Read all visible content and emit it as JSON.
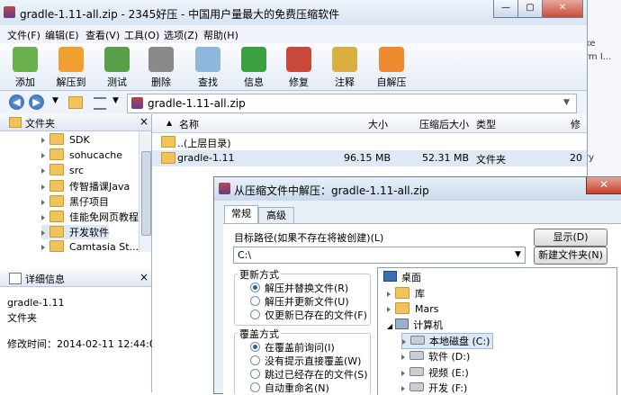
{
  "background_window": {
    "frag1": "ke",
    "frag2": "rm I...",
    "frag3": "ry"
  },
  "window": {
    "title": "gradle-1.11-all.zip - 2345好压 - 中国用户量最大的免费压缩软件"
  },
  "menu": [
    "文件(F)",
    "编辑(E)",
    "查看(V)",
    "工具(O)",
    "选项(Z)",
    "帮助(H)"
  ],
  "toolbar": [
    {
      "label": "添加",
      "icon": "add-archive-icon",
      "color": "#6ab04c"
    },
    {
      "label": "解压到",
      "icon": "extract-to-icon",
      "color": "#f0a030"
    },
    {
      "label": "测试",
      "icon": "test-icon",
      "color": "#5aa04a"
    },
    {
      "label": "删除",
      "icon": "delete-icon",
      "color": "#8a8a8a"
    },
    {
      "label": "查找",
      "icon": "find-icon",
      "color": "#8fb8dc"
    },
    {
      "label": "信息",
      "icon": "info-icon",
      "color": "#3aa040"
    },
    {
      "label": "修复",
      "icon": "repair-icon",
      "color": "#c94a3a"
    },
    {
      "label": "注释",
      "icon": "comment-icon",
      "color": "#d9b040"
    },
    {
      "label": "自解压",
      "icon": "self-extract-icon",
      "color": "#f08a30"
    }
  ],
  "address": {
    "path": "gradle-1.11-all.zip"
  },
  "left_pane": {
    "header": "文件夹",
    "tree": [
      "SDK",
      "sohucache",
      "src",
      "传智播课Java",
      "黑仔项目",
      "佳能免网页教程",
      "开发软件",
      "Camtasia St..."
    ],
    "details_header": "详细信息",
    "detail_name": "gradle-1.11",
    "detail_type": "文件夹",
    "detail_modified": "修改时间：2014-02-11 12:44:02"
  },
  "list": {
    "columns": {
      "name": "名称",
      "size": "大小",
      "packed": "压缩后大小",
      "type": "类型",
      "mod": "修"
    },
    "rows": [
      {
        "name": "..(上层目录)",
        "size": "",
        "packed": "",
        "type": ""
      },
      {
        "name": "gradle-1.11",
        "size": "96.15 MB",
        "packed": "52.31 MB",
        "type": "文件夹",
        "mod": "20"
      }
    ]
  },
  "dialog": {
    "title": "从压缩文件中解压：gradle-1.11-all.zip",
    "tabs": [
      "常规",
      "高级"
    ],
    "dest_label": "目标路径(如果不存在将被创建)(L)",
    "dest_value": "C:\\",
    "show_button": "显示(D)",
    "new_folder_button": "新建文件夹(N)",
    "update_group": "更新方式",
    "update_options": [
      "解压并替换文件(R)",
      "解压并更新文件(U)",
      "仅更新已存在的文件(F)"
    ],
    "overwrite_group": "覆盖方式",
    "overwrite_options": [
      "在覆盖前询问(I)",
      "没有提示直接覆盖(W)",
      "跳过已经存在的文件(S)",
      "自动重命名(N)"
    ],
    "tree": [
      "桌面",
      "库",
      "Mars",
      "计算机",
      "本地磁盘 (C:)",
      "软件 (D:)",
      "视频 (E:)",
      "开发 (F:)"
    ]
  }
}
